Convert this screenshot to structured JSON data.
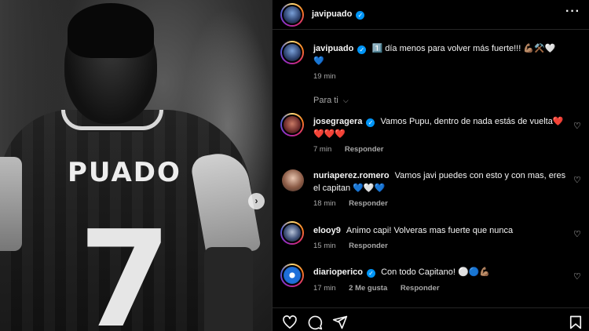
{
  "photo": {
    "jersey_name": "PUADO",
    "jersey_number": "7",
    "next_label": "›"
  },
  "header": {
    "username": "javipuado",
    "more_label": "···"
  },
  "caption": {
    "username": "javipuado",
    "text": "1️⃣ día menos para volver más fuerte!!! 💪🏽⚒️🤍",
    "text2": "💙",
    "time": "19 min"
  },
  "sort": {
    "label": "Para ti"
  },
  "comments": [
    {
      "username": "josegragera",
      "verified": true,
      "text": "Vamos Pupu, dentro de nada estás de vuelta❤️",
      "text2": "❤️❤️❤️",
      "time": "7 min",
      "likes": "",
      "reply": "Responder"
    },
    {
      "username": "nuriaperez.romero",
      "verified": false,
      "text": "Vamos javi puedes con esto y con mas, eres",
      "text2": "el capitan 💙🤍💙",
      "time": "18 min",
      "likes": "",
      "reply": "Responder"
    },
    {
      "username": "elooy9",
      "verified": false,
      "text": "Animo capi! Volveras mas fuerte que nunca",
      "text2": "",
      "time": "15 min",
      "likes": "",
      "reply": "Responder"
    },
    {
      "username": "diarioperico",
      "verified": true,
      "text": "Con todo Capitano! ⚪🔵💪🏽",
      "text2": "",
      "time": "17 min",
      "likes": "2 Me gusta",
      "reply": "Responder"
    }
  ],
  "icons": {
    "like": "heart-icon",
    "comment": "comment-icon",
    "share": "share-icon",
    "save": "bookmark-icon"
  },
  "colors": {
    "background": "#000000",
    "verified": "#0095f6",
    "secondary_text": "#a8a8a8"
  }
}
